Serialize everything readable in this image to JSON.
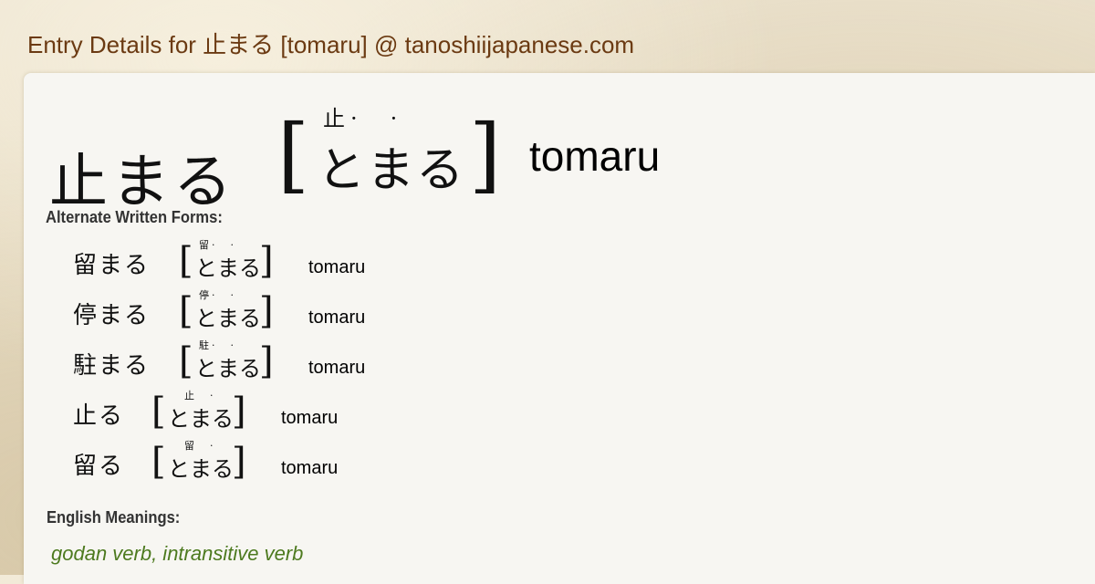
{
  "header": {
    "title": "Entry Details for 止まる [tomaru] @ tanoshiijapanese.com"
  },
  "entry": {
    "word": "止まる",
    "bracket_open": "[",
    "bracket_close": "]",
    "reading": "とまる",
    "furigana": "止·　·",
    "romaji": "tomaru"
  },
  "alternate_forms": {
    "label": "Alternate Written Forms:",
    "items": [
      {
        "word": "留まる",
        "reading": "とまる",
        "furigana": "留·　·",
        "romaji": "tomaru"
      },
      {
        "word": "停まる",
        "reading": "とまる",
        "furigana": "停·　·",
        "romaji": "tomaru"
      },
      {
        "word": "駐まる",
        "reading": "とまる",
        "furigana": "駐·　·",
        "romaji": "tomaru"
      },
      {
        "word": "止る",
        "reading": "とまる",
        "furigana": "止　·",
        "romaji": "tomaru"
      },
      {
        "word": "留る",
        "reading": "とまる",
        "furigana": "留　·",
        "romaji": "tomaru"
      }
    ]
  },
  "meanings": {
    "label": "English Meanings:",
    "part_of_speech": "godan verb, intransitive verb"
  },
  "colors": {
    "header_text": "#6b3a12",
    "meaning_text": "#4d7a1f",
    "card_bg": "#f7f6f2",
    "page_bg": "#e8dcc3"
  }
}
